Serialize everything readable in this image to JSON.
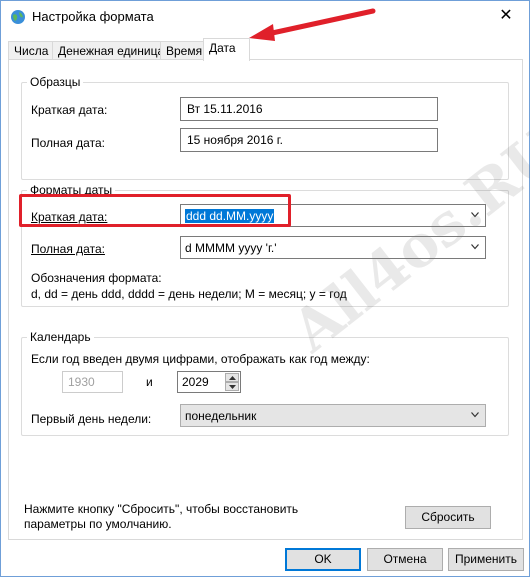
{
  "window": {
    "title": "Настройка формата",
    "close_glyph": "✕"
  },
  "tabs": [
    {
      "label": "Числа"
    },
    {
      "label": "Денежная единица"
    },
    {
      "label": "Время"
    },
    {
      "label": "Дата",
      "active": true
    }
  ],
  "samples": {
    "legend": "Образцы",
    "short_label": "Краткая дата:",
    "short_value": "Вт 15.11.2016",
    "long_label": "Полная дата:",
    "long_value": "15 ноября 2016 г."
  },
  "formats": {
    "legend": "Форматы даты",
    "short_label": "Краткая дата:",
    "short_value": "ddd dd.MM.yyyy",
    "long_label": "Полная дата:",
    "long_value": "d MMMM yyyy 'г.'",
    "notation_title": "Обозначения формата:",
    "notation_text": "d, dd = день  ddd, dddd = день недели; M = месяц; y = год"
  },
  "calendar": {
    "legend": "Календарь",
    "two_digit_label": "Если год введен двумя цифрами, отображать как год между:",
    "year_from": "1930",
    "and_label": "и",
    "year_to": "2029",
    "first_day_label": "Первый день недели:",
    "first_day_value": "понедельник"
  },
  "footer": {
    "reset_hint": "Нажмите кнопку \"Сбросить\", чтобы восстановить параметры по умолчанию.",
    "reset_button": "Сбросить",
    "ok_button": "OK",
    "cancel_button": "Отмена",
    "apply_button": "Применить"
  },
  "watermark": "All4os.RU",
  "colors": {
    "accent": "#0078d7",
    "annotation_red": "#e0202a"
  }
}
